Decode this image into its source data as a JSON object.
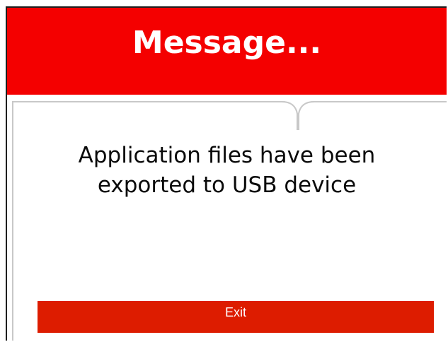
{
  "dialog": {
    "title": "Message...",
    "message_line1": "Application files have been",
    "message_line2": "exported to USB device",
    "exit_label": "Exit"
  },
  "colors": {
    "header_red": "#f40000",
    "button_red": "#dd1c00",
    "frame_gray": "#c8c8c8"
  }
}
